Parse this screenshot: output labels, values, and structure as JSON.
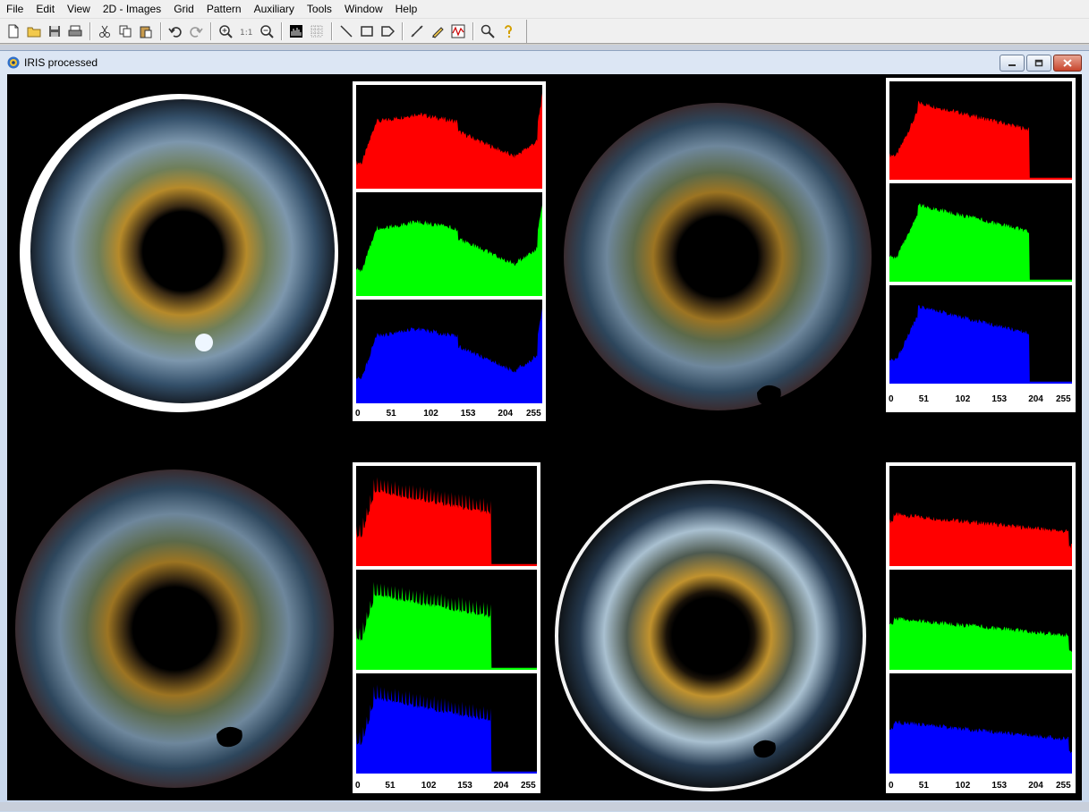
{
  "menu": [
    "File",
    "Edit",
    "View",
    "2D - Images",
    "Grid",
    "Pattern",
    "Auxiliary",
    "Tools",
    "Window",
    "Help"
  ],
  "toolbar_icons": [
    "new-file-icon",
    "open-folder-icon",
    "save-icon",
    "print-icon",
    "cut-icon",
    "copy-icon",
    "paste-icon",
    "undo-icon",
    "redo-icon",
    "zoom-in-icon",
    "actual-size-icon",
    "zoom-out-icon",
    "histogram-icon",
    "grid-icon",
    "line-tool-icon",
    "rectangle-tool-icon",
    "polygon-tool-icon",
    "measure-icon",
    "pencil-icon",
    "waveform-icon",
    "find-icon",
    "help-icon"
  ],
  "window": {
    "title": "IRIS processed"
  },
  "colors": {
    "red": "#ff0000",
    "green": "#00ff00",
    "blue": "#0000ff"
  },
  "histograms": [
    {
      "id": "top-left",
      "axis_ticks": [
        "0",
        "51",
        "102",
        "153",
        "204",
        "255"
      ],
      "profile": "full-u"
    },
    {
      "id": "top-right",
      "axis_ticks": [
        "0",
        "51",
        "102",
        "153",
        "204",
        "255"
      ],
      "profile": "cut-195"
    },
    {
      "id": "bottom-left",
      "axis_ticks": [
        "0",
        "51",
        "102",
        "153",
        "204",
        "255"
      ],
      "profile": "combed-190"
    },
    {
      "id": "bottom-right",
      "axis_ticks": [
        "0",
        "51",
        "102",
        "153",
        "204",
        "255"
      ],
      "profile": "flat-decline"
    }
  ]
}
